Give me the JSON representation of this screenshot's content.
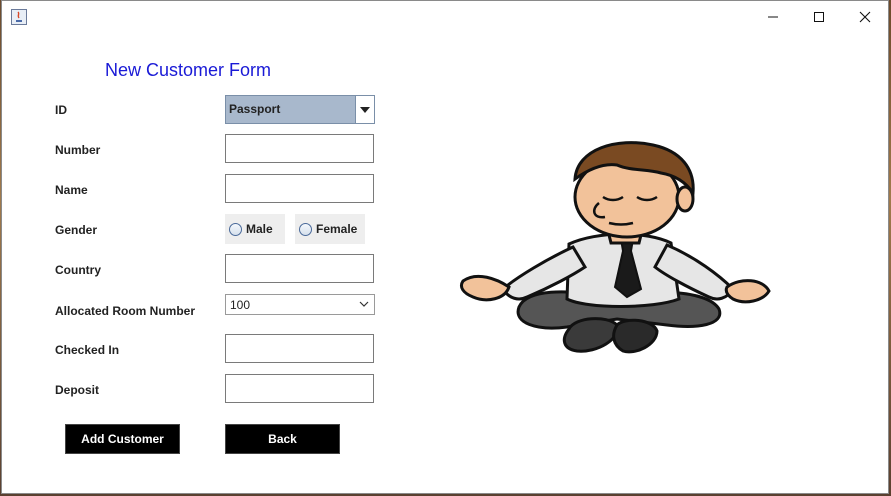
{
  "window": {
    "app_icon": "java-icon",
    "controls": {
      "minimize": "minimize-icon",
      "maximize": "maximize-icon",
      "close": "close-icon"
    }
  },
  "form": {
    "title": "New Customer Form",
    "labels": {
      "id": "ID",
      "number": "Number",
      "name": "Name",
      "gender": "Gender",
      "country": "Country",
      "room": "Allocated Room Number",
      "checked_in": "Checked In",
      "deposit": "Deposit"
    },
    "id_type": {
      "selected": "Passport"
    },
    "number": {
      "value": ""
    },
    "name": {
      "value": ""
    },
    "gender": {
      "male": "Male",
      "female": "Female"
    },
    "country": {
      "value": ""
    },
    "room": {
      "selected": "100"
    },
    "checked_in": {
      "value": ""
    },
    "deposit": {
      "value": ""
    },
    "buttons": {
      "add": "Add Customer",
      "back": "Back"
    }
  },
  "illustration": {
    "icon": "meditating-man-illustration"
  }
}
